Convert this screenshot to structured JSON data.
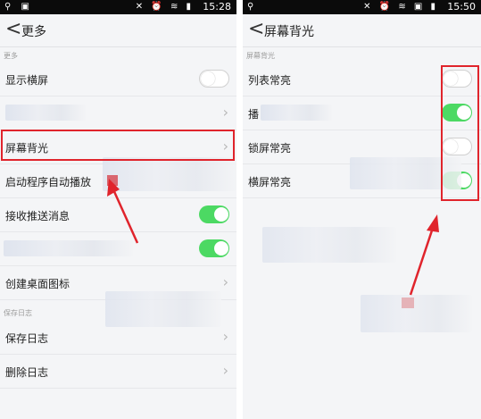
{
  "left": {
    "status": {
      "time": "15:28",
      "network": "3G"
    },
    "header": {
      "back_glyph": "<",
      "title": "更多"
    },
    "section_more": "更多",
    "rows": {
      "landscape": "显示横屏",
      "backlight": "屏幕背光",
      "autoplay": "启动程序自动播放",
      "push": "接收推送消息",
      "shortcut": "创建桌面图标",
      "save_log": "保存日志",
      "delete_log": "删除日志"
    },
    "section_log": "保存日志",
    "toggles": {
      "landscape": "off",
      "push": "on",
      "blurred": "on"
    }
  },
  "right": {
    "status": {
      "time": "15:50",
      "network": "3G"
    },
    "header": {
      "back_glyph": "<",
      "title": "屏幕背光"
    },
    "section": "屏幕背光",
    "rows": {
      "list": "列表常亮",
      "play": "播",
      "lock": "锁屏常亮",
      "landscape": "横屏常亮"
    },
    "toggles": {
      "list": "off",
      "play": "on",
      "lock": "off",
      "landscape": "on"
    }
  },
  "colors": {
    "accent_red": "#e0242c",
    "toggle_on": "#4cd963",
    "status_bar": "#0b0b0b"
  }
}
